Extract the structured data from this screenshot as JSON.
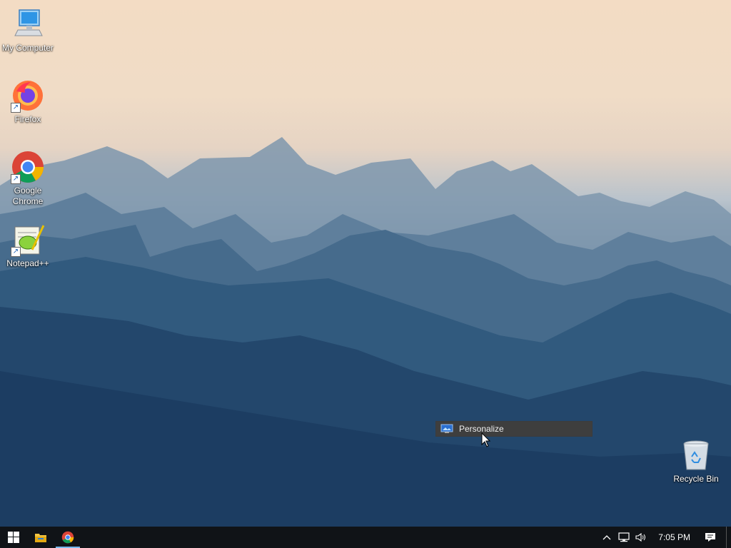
{
  "desktop": {
    "icons": [
      {
        "label": "My Computer",
        "icon": "computer-icon"
      },
      {
        "label": "Firefox",
        "icon": "firefox-icon"
      },
      {
        "label": "Google Chrome",
        "icon": "chrome-icon"
      },
      {
        "label": "Notepad++",
        "icon": "notepad-plus-plus-icon"
      },
      {
        "label": "Recycle Bin",
        "icon": "recycle-bin-icon"
      }
    ]
  },
  "context_menu": {
    "items": [
      {
        "label": "Personalize",
        "icon": "personalize-icon"
      }
    ]
  },
  "taskbar": {
    "start": "windows-logo-icon",
    "pinned": [
      {
        "name": "File Explorer",
        "icon": "folder-icon"
      },
      {
        "name": "Google Chrome",
        "icon": "chrome-icon",
        "active": true
      }
    ],
    "tray": {
      "icons": [
        "chevron-up-icon",
        "network-icon",
        "volume-icon"
      ],
      "clock": "7:05 PM",
      "notification_icon": "action-center-icon"
    }
  },
  "colors": {
    "taskbar_bg": "#101317",
    "active_indicator": "#76b9ed",
    "menu_bg": "#2b2b2b",
    "menu_highlight": "#3e3e3e"
  }
}
